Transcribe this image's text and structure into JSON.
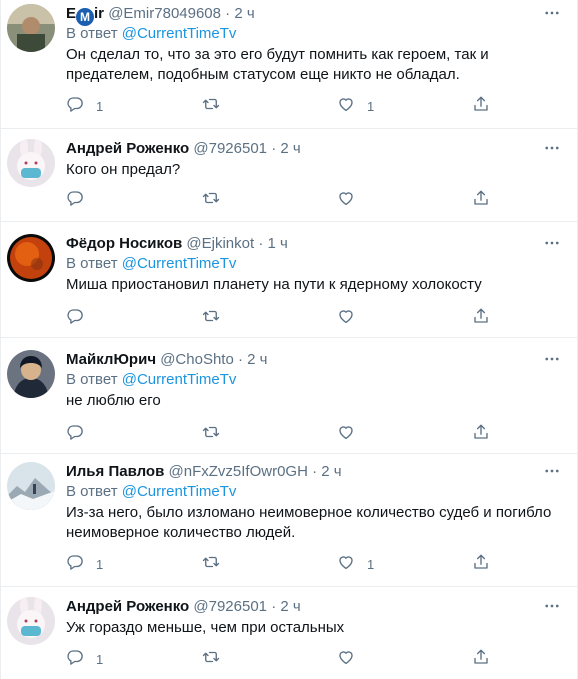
{
  "tweets": [
    {
      "name_pre": "E",
      "name_logo": "M",
      "name_post": "ir",
      "handle": "@Emir78049608",
      "time": "2 ч",
      "reply_prefix": "В ответ",
      "reply_mention": "@CurrentTimeTv",
      "text": "Он сделал то, что за это его будут помнить как героем, так и предателем, подобным статусом еще никто не обладал.",
      "reply_count": "1",
      "retweet_count": "",
      "like_count": "1"
    },
    {
      "name": "Андрей Роженко",
      "handle": "@7926501",
      "time": "2 ч",
      "text": "Кого он предал?",
      "reply_count": "",
      "retweet_count": "",
      "like_count": ""
    },
    {
      "name": "Фёдор Носиков",
      "handle": "@Ejkinkot",
      "time": "1 ч",
      "reply_prefix": "В ответ",
      "reply_mention": "@CurrentTimeTv",
      "text": "Миша приостановил планету на пути к ядерному холокосту",
      "reply_count": "",
      "retweet_count": "",
      "like_count": ""
    },
    {
      "name": "МайклЮрич",
      "handle": "@ChoShto",
      "time": "2 ч",
      "reply_prefix": "В ответ",
      "reply_mention": "@CurrentTimeTv",
      "text": "не люблю его",
      "reply_count": "",
      "retweet_count": "",
      "like_count": ""
    },
    {
      "name": "Илья Павлов",
      "handle": "@nFxZvz5IfOwr0GH",
      "time": "2 ч",
      "reply_prefix": "В ответ",
      "reply_mention": "@CurrentTimeTv",
      "text": "Из-за него, было изломано неимоверное количество судеб и погибло неимоверное количество людей.",
      "reply_count": "1",
      "retweet_count": "",
      "like_count": "1"
    },
    {
      "name": "Андрей Роженко",
      "handle": "@7926501",
      "time": "2 ч",
      "text": "Уж гораздо меньше, чем при остальных",
      "reply_count": "1",
      "retweet_count": "",
      "like_count": ""
    }
  ],
  "separator": "·",
  "icons": {
    "reply": "reply-icon",
    "retweet": "retweet-icon",
    "like": "like-icon",
    "share": "share-icon",
    "more": "more-icon"
  },
  "colors": {
    "mention": "#1b95e0",
    "secondary": "#5b7083",
    "divider": "#ebeef0"
  }
}
